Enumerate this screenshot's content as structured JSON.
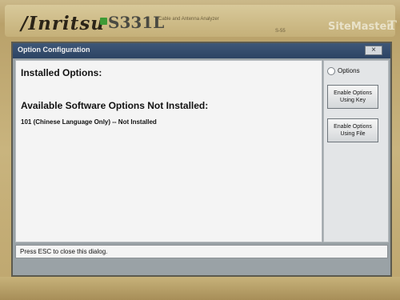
{
  "device": {
    "brand": "/Inritsu",
    "model": "S331L",
    "subtitle": "Cable and Antenna Analyzer",
    "code": "S-55",
    "product_name": "SiteMaster",
    "logo_glyph": "T",
    "accent_green": "#3d9a36"
  },
  "dialog": {
    "title": "Option Configuration",
    "close_glyph": "×",
    "installed_heading": "Installed Options:",
    "available_heading": "Available Software Options Not Installed:",
    "options": [
      "101 (Chinese Language Only) -- Not Installed"
    ],
    "title_bar_color": "#34506f"
  },
  "side_panel": {
    "radio_label": "Options",
    "buttons": [
      {
        "line1": "Enable Options",
        "line2": "Using Key"
      },
      {
        "line1": "Enable Options",
        "line2": "Using File"
      }
    ]
  },
  "status": {
    "text": "Press ESC to close this dialog."
  }
}
